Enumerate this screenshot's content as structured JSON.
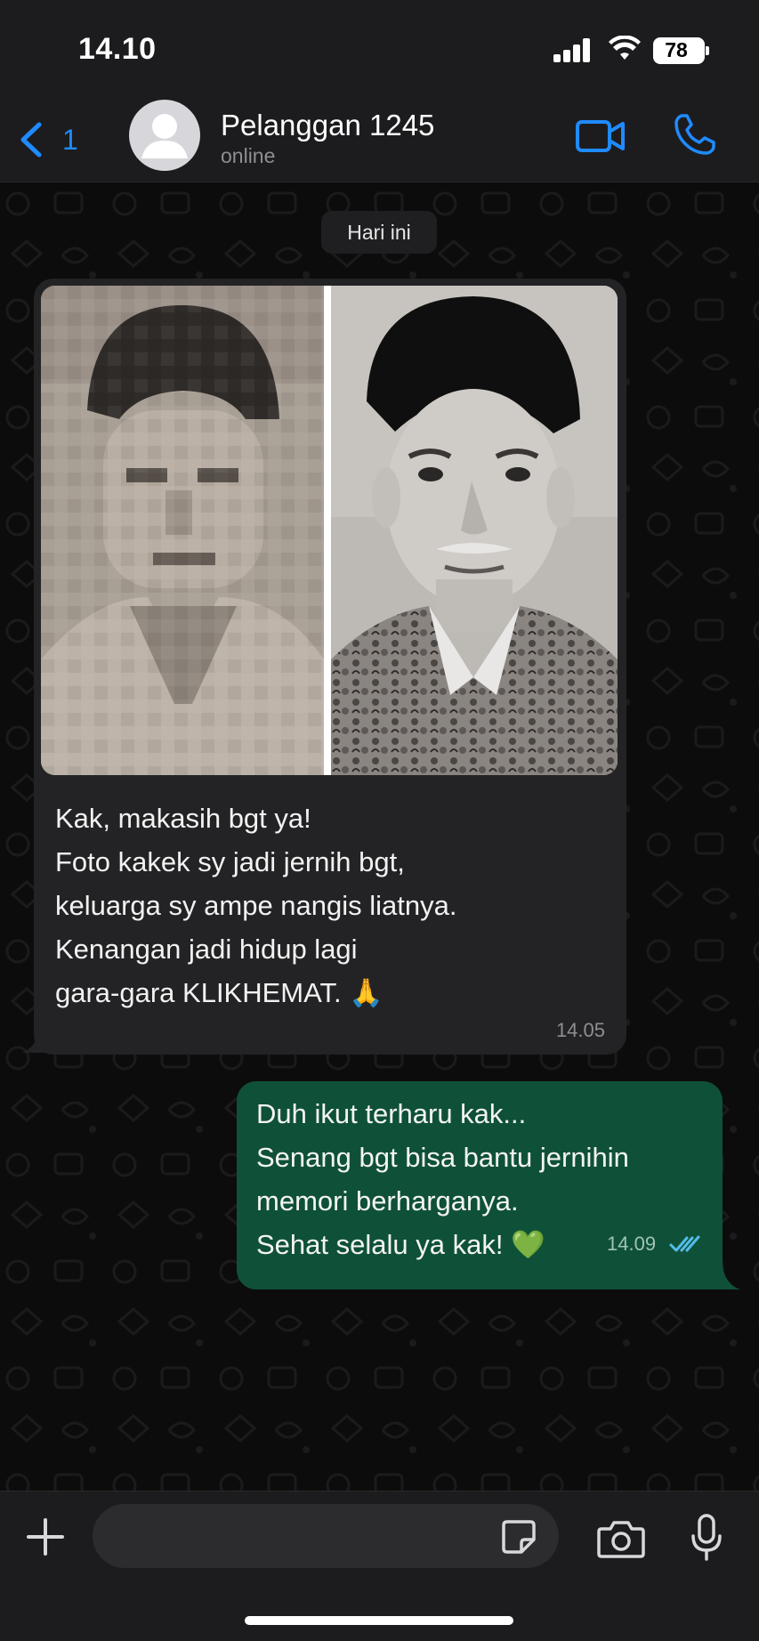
{
  "status_bar": {
    "time": "14.10",
    "battery": "78"
  },
  "header": {
    "back_count": "1",
    "contact_name": "Pelanggan 1245",
    "contact_status": "online",
    "icons": [
      "chevron-left-icon",
      "avatar-icon",
      "video-call-icon",
      "phone-icon"
    ]
  },
  "chat": {
    "date_chip": "Hari ini",
    "incoming": {
      "image_caption": "before-after photo restoration of elderly man with black cap",
      "lines": [
        "Kak, makasih bgt ya!",
        "Foto kakek sy jadi jernih bgt,",
        "keluarga sy ampe nangis liatnya.",
        "Kenangan jadi hidup lagi",
        "gara-gara KLIKHEMAT. 🙏"
      ],
      "time": "14.05"
    },
    "outgoing": {
      "lines": [
        "Duh ikut terharu kak...",
        "Senang bgt bisa bantu jernihin",
        "memori berharganya.",
        "Sehat selalu ya kak! 💚"
      ],
      "time": "14.09",
      "status": "read"
    }
  },
  "input_bar": {
    "placeholder": "",
    "icons": [
      "plus-icon",
      "sticker-icon",
      "camera-icon",
      "microphone-icon"
    ]
  },
  "colors": {
    "accent": "#1f8bff",
    "incoming_bubble": "#232325",
    "outgoing_bubble": "#0f5138",
    "read_tick": "#53bdeb"
  }
}
